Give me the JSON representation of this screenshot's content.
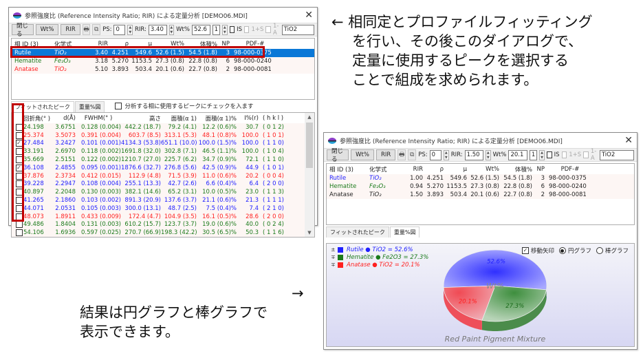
{
  "dialog": {
    "title": "参照強度比 (Reference Intensity Ratio; RIR) による定量分析 [DEMO06.MDI]",
    "close_glyph": "✕",
    "toolbar": {
      "close_label": "閉じる",
      "wt_label": "Wt%",
      "rir_label": "RIR",
      "ps_label": "PS:",
      "rir_field_label": "RIR:",
      "wt_field_label": "Wt%",
      "is_label": "IS",
      "is_s_label": "1+S",
      "one_a_label": "1-A",
      "spin_up": "▲",
      "spin_down": "▼"
    },
    "phase_columns": [
      "相 ID (3)",
      "化学式",
      "RIR",
      "ρ",
      "μ",
      "Wt%",
      "体積%",
      "NP",
      "PDF-#"
    ],
    "tabs": [
      "フィットされたピーク",
      "重量%図"
    ]
  },
  "left_dialog": {
    "toolbar_values": {
      "ps": "0",
      "rir": "3.40",
      "wt": "52.6",
      "index": "1",
      "formula": "TiO2"
    },
    "phases": [
      {
        "id": "Rutile",
        "formula": "TiO₂",
        "rir": "3.40",
        "rho": "4.251",
        "mu": "549.6",
        "wt": "52.6 (1.5)",
        "vol": "54.5 (1.8)",
        "np": "3",
        "pdf": "98-000-0375",
        "color": "blue",
        "selected": true
      },
      {
        "id": "Hematite",
        "formula": "Fe₂O₃",
        "rir": "3.18",
        "rho": "5.270",
        "mu": "1153.5",
        "wt": "27.3 (0.8)",
        "vol": "22.8 (0.8)",
        "np": "6",
        "pdf": "98-000-0240",
        "color": "green"
      },
      {
        "id": "Anatase",
        "formula": "TiO₂",
        "rir": "5.10",
        "rho": "3.893",
        "mu": "503.4",
        "wt": "20.1 (0.6)",
        "vol": "22.7 (0.8)",
        "np": "2",
        "pdf": "98-000-0081",
        "color": "red"
      }
    ],
    "active_tab": 0,
    "check_label": "分析する相に使用するピークにチェックを入ます",
    "peak_columns": [
      "回折角(° )",
      "d(Å)",
      "FWHM(° )",
      "高さ",
      "面積(α 1)",
      "面積(α 1)%",
      "I%(r)",
      "( h k l )"
    ],
    "peaks": [
      {
        "checked": false,
        "angle": "24.198",
        "d": "3.6751",
        "fwhm": "0.128 (0.004)",
        "height": "442.2 (18.7)",
        "area": "79.2 (4.1)",
        "area_pct": "12.2 (0.6)%",
        "ir": "30.7",
        "hkl": "( 0 1 2)",
        "color": "green"
      },
      {
        "checked": false,
        "angle": "25.374",
        "d": "3.5073",
        "fwhm": "0.391 (0.004)",
        "height": "603.7 (8.5)",
        "area": "313.1 (5.3)",
        "area_pct": "48.1 (0.8)%",
        "ir": "100.0",
        "hkl": "( 1 0 1)",
        "color": "red"
      },
      {
        "checked": true,
        "angle": "27.484",
        "d": "3.2427",
        "fwhm": "0.101 (0.001)",
        "height": "4134.3 (53.8)",
        "area": "651.1 (10.0)",
        "area_pct": "100.0 (1.5)%",
        "ir": "100.0",
        "hkl": "( 1 1 0)",
        "color": "blue"
      },
      {
        "checked": false,
        "angle": "33.191",
        "d": "2.6970",
        "fwhm": "0.118 (0.002)",
        "height": "1691.8 (32.0)",
        "area": "302.8 (7.1)",
        "area_pct": "46.5 (1.1)%",
        "ir": "100.0",
        "hkl": "( 1 0 4)",
        "color": "green"
      },
      {
        "checked": false,
        "angle": "35.669",
        "d": "2.5151",
        "fwhm": "0.122 (0.002)",
        "height": "1210.7 (27.0)",
        "area": "225.7 (6.2)",
        "area_pct": "34.7 (0.9)%",
        "ir": "72.1",
        "hkl": "( 1 1 0)",
        "color": "green"
      },
      {
        "checked": true,
        "angle": "36.108",
        "d": "2.4855",
        "fwhm": "0.095 (0.001)",
        "height": "1876.6 (32.7)",
        "area": "276.8 (5.6)",
        "area_pct": "42.5 (0.9)%",
        "ir": "44.9",
        "hkl": "( 1 0 1)",
        "color": "blue"
      },
      {
        "checked": false,
        "angle": "37.876",
        "d": "2.3734",
        "fwhm": "0.412 (0.015)",
        "height": "112.9 (4.8)",
        "area": "71.5 (3.9)",
        "area_pct": "11.0 (0.6)%",
        "ir": "20.2",
        "hkl": "( 0 0 4)",
        "color": "red"
      },
      {
        "checked": false,
        "angle": "39.228",
        "d": "2.2947",
        "fwhm": "0.108 (0.004)",
        "height": "255.1 (13.3)",
        "area": "42.7 (2.6)",
        "area_pct": "6.6 (0.4)%",
        "ir": "6.4",
        "hkl": "( 2 0 0)",
        "color": "blue"
      },
      {
        "checked": false,
        "angle": "40.897",
        "d": "2.2048",
        "fwhm": "0.130 (0.003)",
        "height": "382.1 (14.6)",
        "area": "65.2 (3.1)",
        "area_pct": "10.0 (0.5)%",
        "ir": "23.0",
        "hkl": "( 1 1 3)",
        "color": "green"
      },
      {
        "checked": false,
        "angle": "41.265",
        "d": "2.1860",
        "fwhm": "0.103 (0.002)",
        "height": "891.3 (20.9)",
        "area": "137.6 (3.7)",
        "area_pct": "21.1 (0.6)%",
        "ir": "21.3",
        "hkl": "( 1 1 1)",
        "color": "blue"
      },
      {
        "checked": false,
        "angle": "44.071",
        "d": "2.0531",
        "fwhm": "0.105 (0.003)",
        "height": "300.0 (13.1)",
        "area": "48.7 (2.5)",
        "area_pct": "7.5 (0.4)%",
        "ir": "7.4",
        "hkl": "( 2 1 0)",
        "color": "blue"
      },
      {
        "checked": false,
        "angle": "48.073",
        "d": "1.8911",
        "fwhm": "0.433 (0.009)",
        "height": "172.4 (4.7)",
        "area": "104.9 (3.5)",
        "area_pct": "16.1 (0.5)%",
        "ir": "28.6",
        "hkl": "( 2 0 0)",
        "color": "red"
      },
      {
        "checked": false,
        "angle": "49.486",
        "d": "1.8404",
        "fwhm": "0.131 (0.003)",
        "height": "610.2 (15.7)",
        "area": "123.7 (3.7)",
        "area_pct": "19.0 (0.6)%",
        "ir": "40.0",
        "hkl": "( 0 2 4)",
        "color": "green"
      },
      {
        "checked": false,
        "angle": "54.106",
        "d": "1.6936",
        "fwhm": "0.597 (0.025)",
        "height": "270.7 (66.9)",
        "area": "198.3 (42.2)",
        "area_pct": "30.5 (6.5)%",
        "ir": "50.3",
        "hkl": "( 1 1 6)",
        "color": "green"
      }
    ]
  },
  "right_dialog": {
    "toolbar_values": {
      "ps": "0",
      "rir": "1.50",
      "wt": "20.1",
      "index": "1",
      "formula": "TiO2"
    },
    "phases": [
      {
        "id": "Rutile",
        "formula": "TiO₂",
        "rir": "1.00",
        "rho": "4.251",
        "mu": "549.6",
        "wt": "52.6 (1.5)",
        "vol": "54.5 (1.8)",
        "np": "3",
        "pdf": "98-000-0375",
        "color": "blue"
      },
      {
        "id": "Hematite",
        "formula": "Fe₂O₃",
        "rir": "0.94",
        "rho": "5.270",
        "mu": "1153.5",
        "wt": "27.3 (0.8)",
        "vol": "22.8 (0.8)",
        "np": "6",
        "pdf": "98-000-0240",
        "color": "green"
      },
      {
        "id": "Anatase",
        "formula": "TiO₂",
        "rir": "1.50",
        "rho": "3.893",
        "mu": "503.4",
        "wt": "20.1 (0.6)",
        "vol": "22.7 (0.8)",
        "np": "2",
        "pdf": "98-000-0081",
        "color": "black"
      }
    ],
    "active_tab": 1,
    "options": {
      "move_arrow_label": "移動矢印",
      "pie_label": "円グラフ",
      "bar_label": "棒グラフ",
      "move_arrow_checked": true,
      "mode": "pie"
    },
    "legend": [
      {
        "move": "±",
        "text": "Rutile ● TiO2 = 52.6%",
        "color": "#2020ff"
      },
      {
        "move": "∓",
        "text": "Hematite ● Fe2O3 = 27.3%",
        "color": "#1a7a1a"
      },
      {
        "move": "∓",
        "text": "Anatase ● TiO2 = 20.1%",
        "color": "#ff2020"
      }
    ]
  },
  "chart_data": {
    "type": "pie",
    "title": "Red Paint Pigment Mixture",
    "center_label": "Wt%",
    "categories": [
      "Rutile",
      "Hematite",
      "Anatase"
    ],
    "values": [
      52.6,
      27.3,
      20.1
    ],
    "labels": [
      "52.6%",
      "27.3%",
      "20.1%"
    ],
    "colors": [
      "#5a5aff",
      "#4e9a4e",
      "#f05a64"
    ],
    "label_colors": [
      "#2020ff",
      "#1a6a1a",
      "#ff2020"
    ]
  },
  "annotations": {
    "top_arrow": "←",
    "top_lines": [
      "相同定とプロファイルフィッティング",
      "を行い、その後このダイアログで、",
      "定量に使用するピークを選択する",
      "ことで組成を求められます。"
    ],
    "bottom_arrow": "→",
    "bottom_lines": [
      "結果は円グラフと棒グラフで",
      "表示できます。"
    ]
  }
}
